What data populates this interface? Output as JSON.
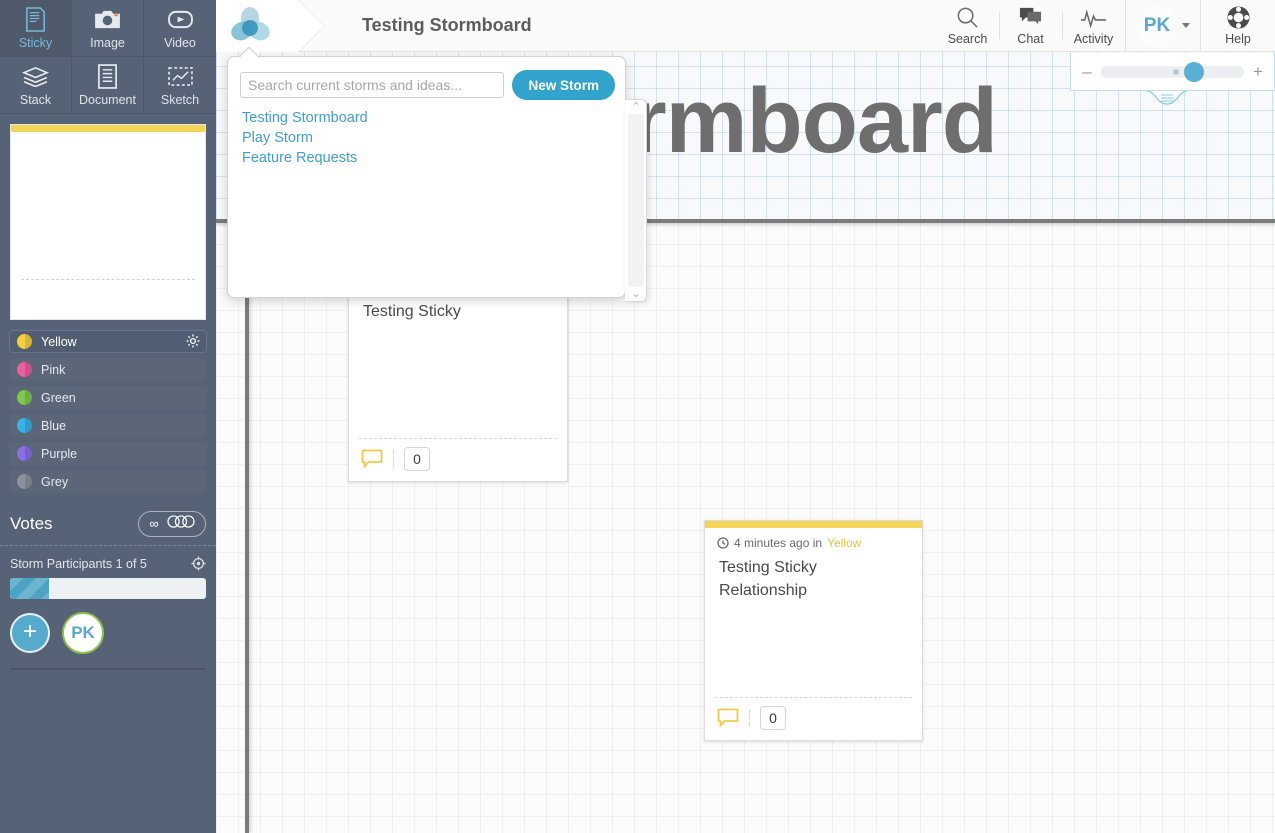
{
  "app": {
    "storm_title": "Testing Stormboard",
    "watermark_text": "tormboard",
    "logo_name": "stormboard-logo"
  },
  "topbar": {
    "actions": [
      {
        "label": "Search",
        "icon": "search-icon"
      },
      {
        "label": "Chat",
        "icon": "chat-icon"
      },
      {
        "label": "Activity",
        "icon": "activity-icon"
      }
    ],
    "user": {
      "initials": "PK",
      "caret": "▾"
    },
    "help": {
      "label": "Help",
      "icon": "lifebuoy-icon"
    }
  },
  "zoom_control": {
    "minus": "–",
    "plus": "+",
    "handle_name": "zoom-slider-handle"
  },
  "storm_panel": {
    "search_placeholder": "Search current storms and ideas...",
    "search_value": "",
    "new_storm_label": "New Storm",
    "storms": [
      "Testing Stormboard",
      "Play Storm",
      "Feature Requests"
    ],
    "scroll_up": "⌃",
    "scroll_down": "⌄"
  },
  "sidebar": {
    "tools": [
      {
        "label": "Sticky",
        "icon": "sticky-note-icon",
        "selected": true
      },
      {
        "label": "Image",
        "icon": "camera-icon",
        "selected": false
      },
      {
        "label": "Video",
        "icon": "video-play-icon",
        "selected": false
      },
      {
        "label": "Stack",
        "icon": "layers-icon",
        "selected": false
      },
      {
        "label": "Document",
        "icon": "document-icon",
        "selected": false
      },
      {
        "label": "Sketch",
        "icon": "sketch-chart-icon",
        "selected": false
      }
    ],
    "colors": [
      {
        "label": "Yellow",
        "hex": "#f5cf3e",
        "active": true
      },
      {
        "label": "Pink",
        "hex": "#ef5d9e",
        "active": false
      },
      {
        "label": "Green",
        "hex": "#7ec94b",
        "active": false
      },
      {
        "label": "Blue",
        "hex": "#39b3e5",
        "active": false
      },
      {
        "label": "Purple",
        "hex": "#8a6fe8",
        "active": false
      },
      {
        "label": "Grey",
        "hex": "#8d939c",
        "active": false
      }
    ],
    "gear_icon": "gear-icon",
    "votes": {
      "label": "Votes",
      "infinity": "∞",
      "chips_icon": "vote-chips-icon"
    },
    "participants": {
      "label": "Storm Participants 1 of 5",
      "target_icon": "target-icon",
      "fill_percent": 20,
      "add_label": "+",
      "avatar_initials": "PK"
    }
  },
  "notes": [
    {
      "id": "note-1",
      "text": "Testing Sticky",
      "comment_count": "0",
      "comment_icon": "comment-bubble-icon",
      "meta": null
    },
    {
      "id": "note-2",
      "text": "Testing Sticky Relationship",
      "comment_count": "0",
      "comment_icon": "comment-bubble-icon",
      "meta": {
        "clock_icon": "clock-icon",
        "time": "4 minutes ago in",
        "color": "Yellow"
      }
    }
  ]
}
